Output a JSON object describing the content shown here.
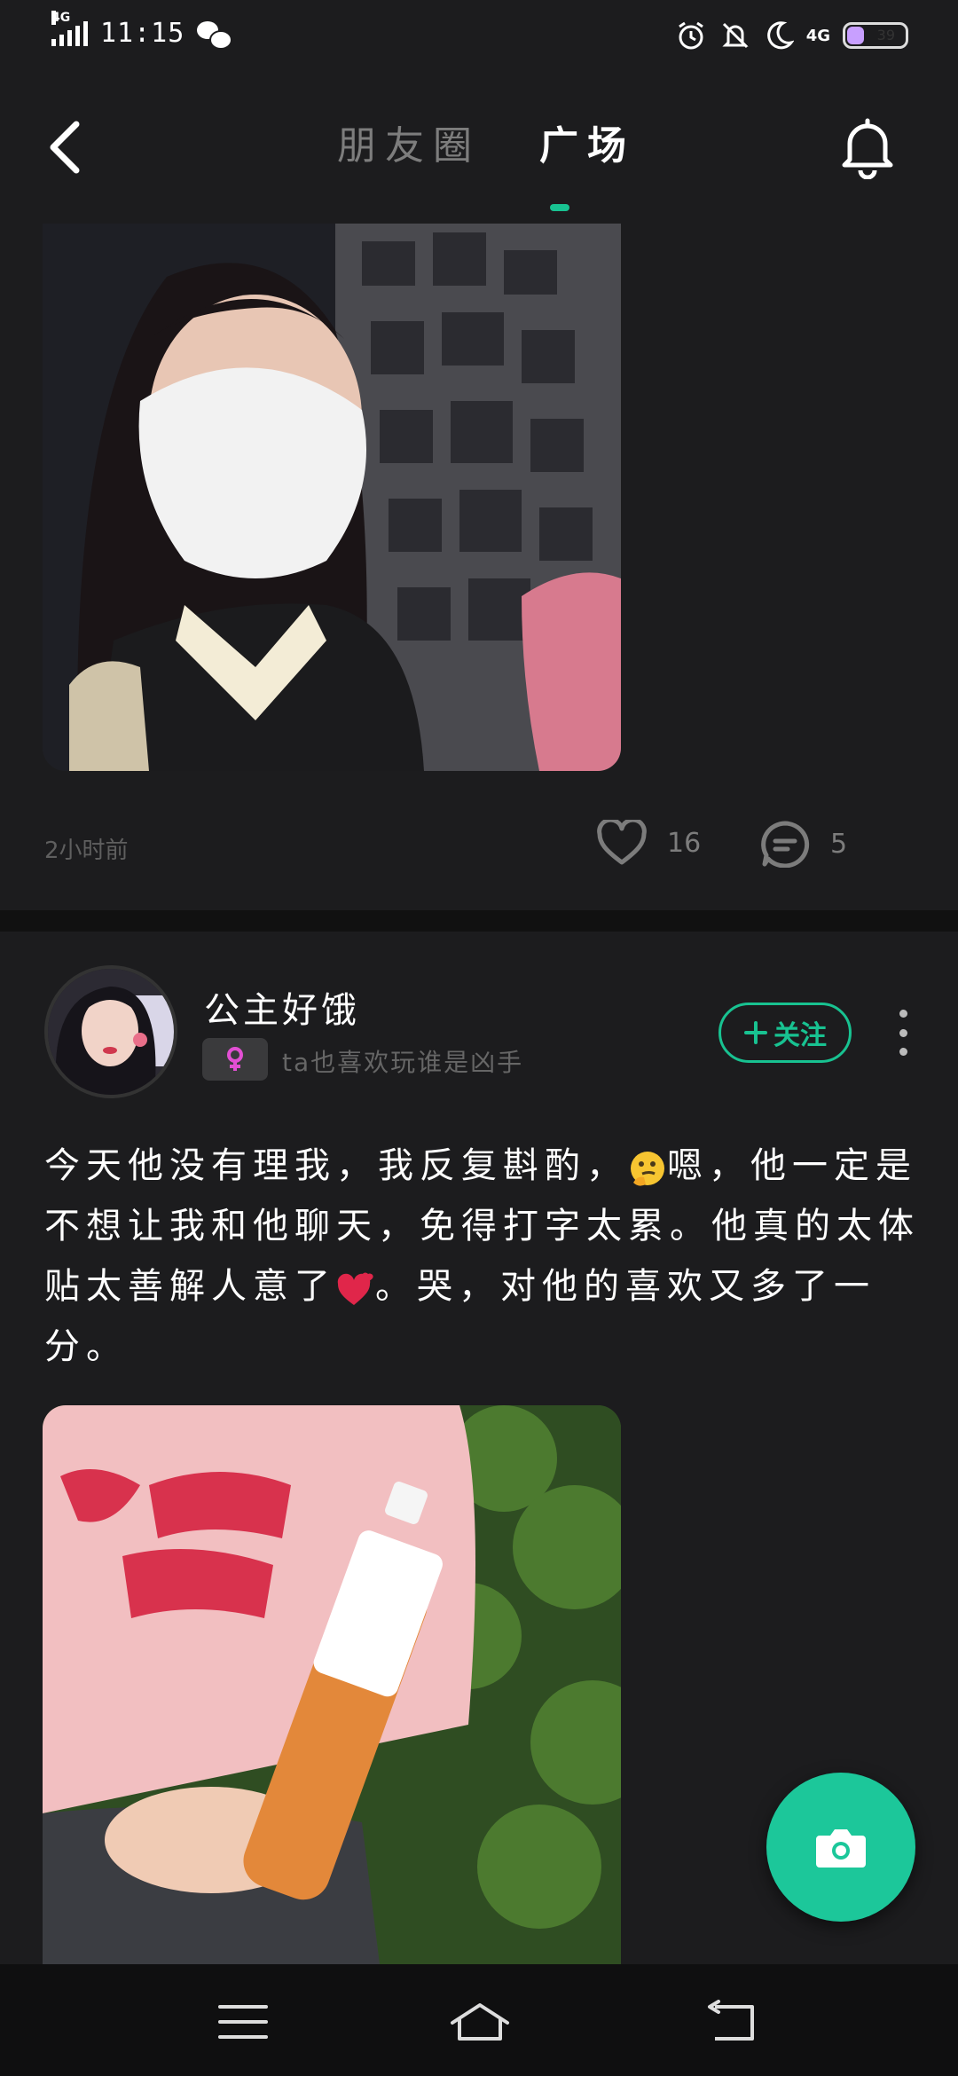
{
  "status_bar": {
    "network": "4G",
    "time": "11:15",
    "battery": "39",
    "right_network": "4G"
  },
  "header": {
    "tabs": [
      {
        "label": "朋友圈",
        "active": false
      },
      {
        "label": "广场",
        "active": true
      }
    ],
    "accent": "#18c291"
  },
  "post1": {
    "time": "2小时前",
    "likes": "16",
    "comments": "5"
  },
  "post2": {
    "username": "公主好饿",
    "bio": "ta也喜欢玩谁是凶手",
    "follow_label": "关注",
    "text_part1": "今天他没有理我，我反复斟酌，",
    "text_part2": "嗯，他一定是不想让我和他聊天，免得打字太累。他真的太体贴太善解人意了",
    "text_part3": "。哭，对他的喜欢又多了一分。",
    "emoji1": "thinking-face-emoji",
    "emoji2": "two-hearts-emoji"
  },
  "icons": {
    "back": "chevron-left-icon",
    "bell": "bell-icon",
    "like": "heart-icon",
    "comment": "comment-icon",
    "camera": "camera-icon",
    "more": "more-vertical-icon"
  }
}
